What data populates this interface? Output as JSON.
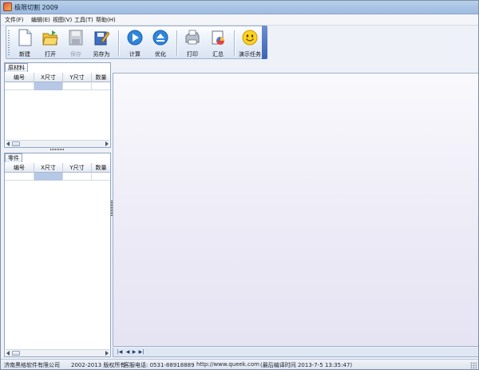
{
  "window": {
    "title": "极限切割 2009"
  },
  "menu": [
    "文件(F)",
    "编辑(E)",
    "视图(V)",
    "工具(T)",
    "帮助(H)"
  ],
  "toolbar": {
    "new": "新建",
    "open": "打开",
    "save": "保存",
    "save_as": "另存为",
    "calc": "计算",
    "optimize": "优化",
    "print": "打印",
    "summary": "汇总",
    "demo": "演示任务"
  },
  "panels": {
    "raw_material": {
      "tab": "原材料",
      "columns": [
        "编号",
        "X尺寸",
        "Y尺寸",
        "数量"
      ]
    },
    "parts": {
      "tab": "零件",
      "columns": [
        "编号",
        "X尺寸",
        "Y尺寸",
        "数量"
      ]
    }
  },
  "sheet_nav": [
    "|◀",
    "◀",
    "▶",
    "▶|"
  ],
  "status": {
    "company": "济南黑格软件有限公司",
    "copyright": "2002-2013 版权所有",
    "phone": "客服电话: 0531-88918889",
    "website": "http://www.queek.com",
    "build": "(最后编译时间 2013-7-5 13:35:47)"
  },
  "colors": {
    "titlebar": "#a7c3e4",
    "selection": "#b6c8e6",
    "main_area": "#eceaf6"
  }
}
